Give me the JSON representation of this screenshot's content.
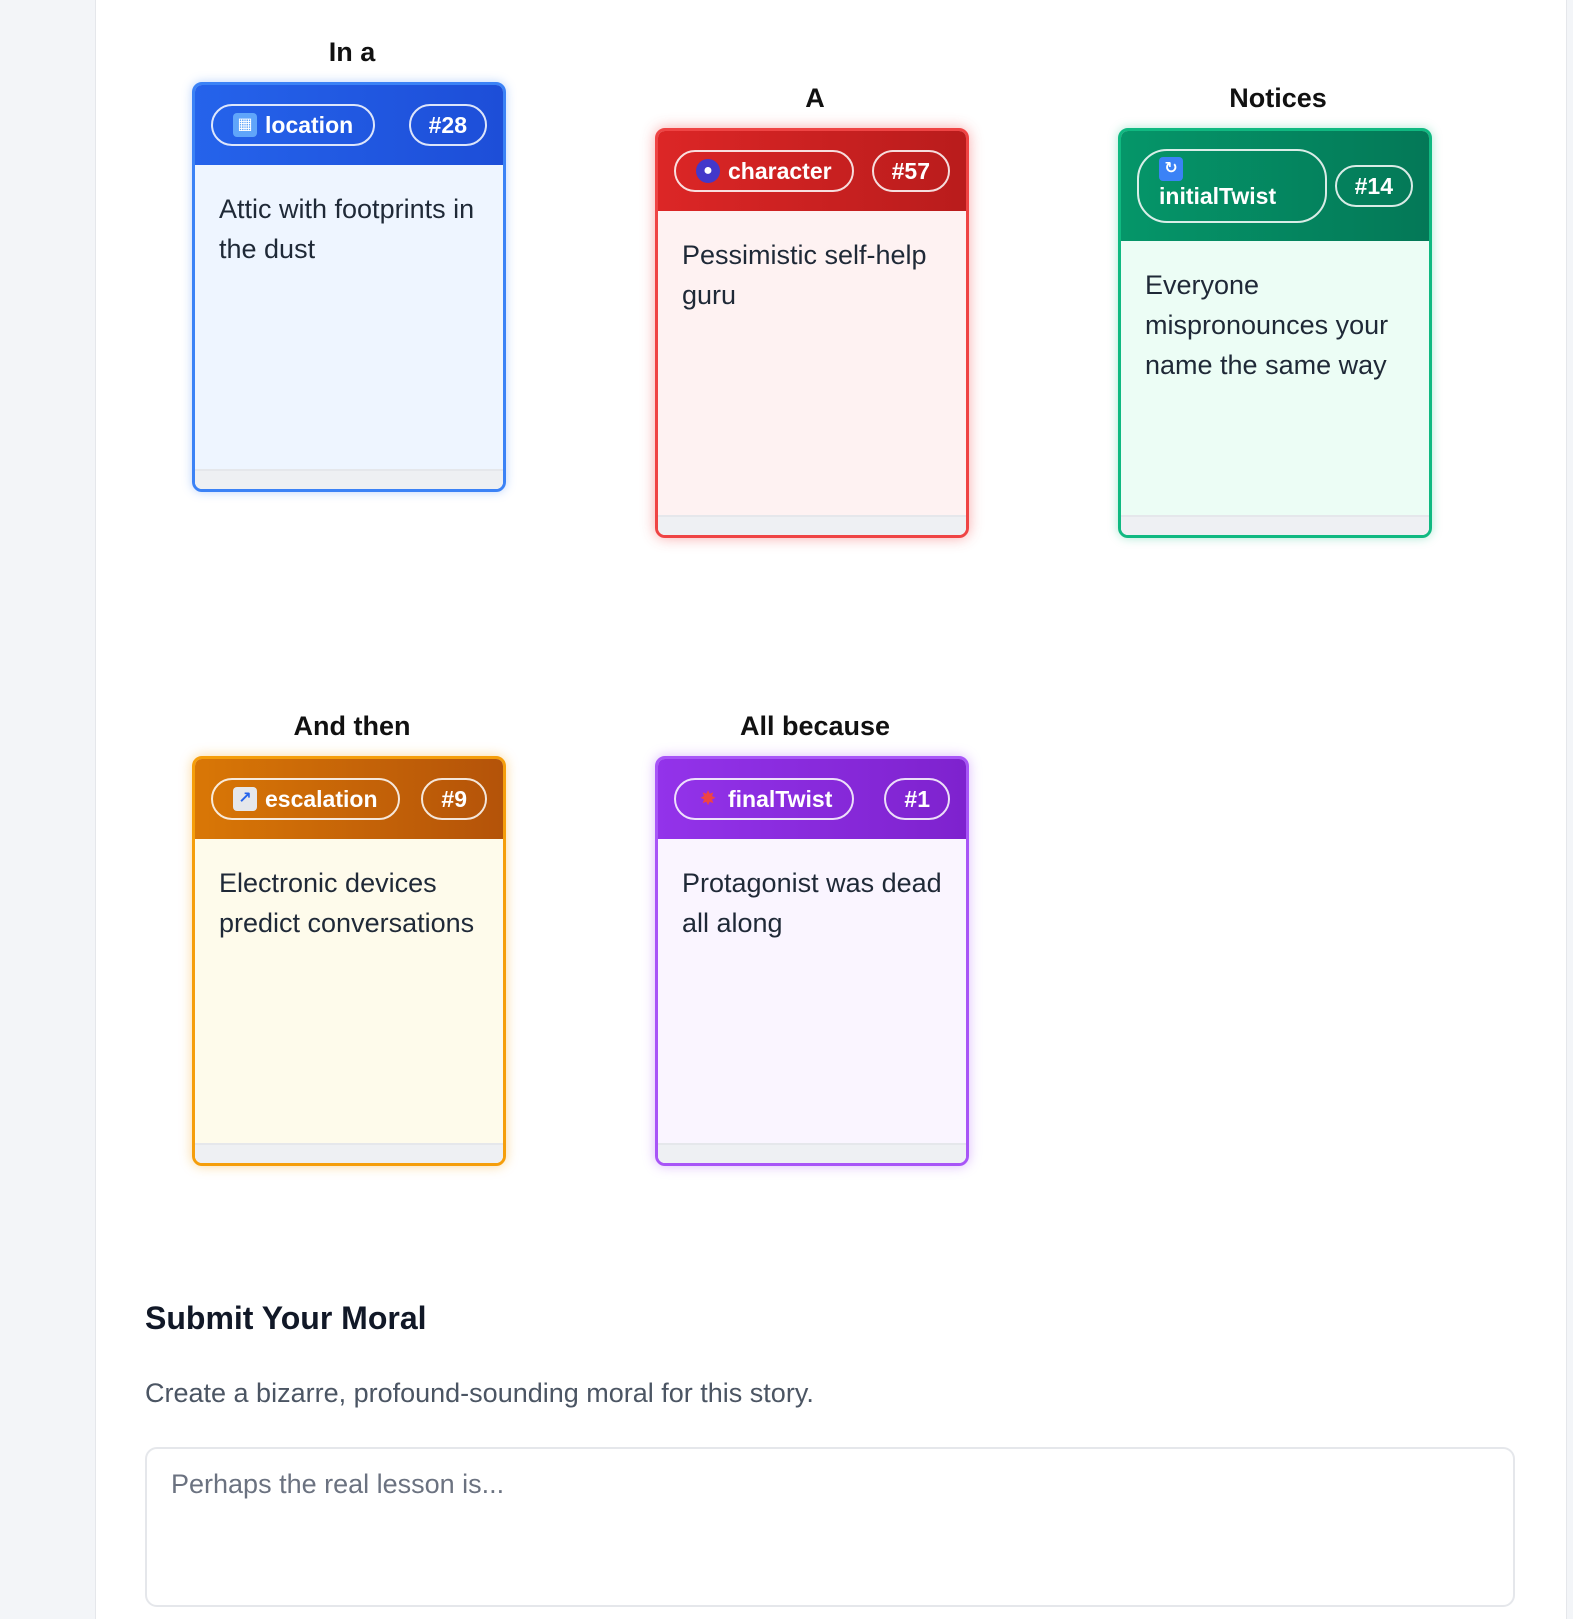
{
  "cards": [
    {
      "label": "In a",
      "category": "location",
      "icon": "cityscape-icon",
      "icon_glyph": "▦",
      "icon_color": "#60a5fa",
      "number": "#28",
      "text": "Attic with footprints in the dust"
    },
    {
      "label": "A",
      "category": "character",
      "icon": "person-silhouette-icon",
      "icon_glyph": "●",
      "icon_color": "#4338ca",
      "number": "#57",
      "text": "Pessimistic self-help guru"
    },
    {
      "label": "Notices",
      "category": "initialTwist",
      "icon": "refresh-arrows-icon",
      "icon_glyph": "↻",
      "icon_color": "#3b82f6",
      "number": "#14",
      "text": "Everyone mispronounces your name the same way"
    },
    {
      "label": "And then",
      "category": "escalation",
      "icon": "chart-increasing-icon",
      "icon_glyph": "↗",
      "icon_color": "#e5e7eb",
      "number": "#9",
      "text": "Electronic devices predict conversations"
    },
    {
      "label": "All because",
      "category": "finalTwist",
      "icon": "explosion-icon",
      "icon_glyph": "✸",
      "icon_color": "#ef4444",
      "number": "#1",
      "text": "Protagonist was dead all along"
    }
  ],
  "moral": {
    "title": "Submit Your Moral",
    "description": "Create a bizarre, profound-sounding moral for this story.",
    "placeholder": "Perhaps the real lesson is..."
  }
}
